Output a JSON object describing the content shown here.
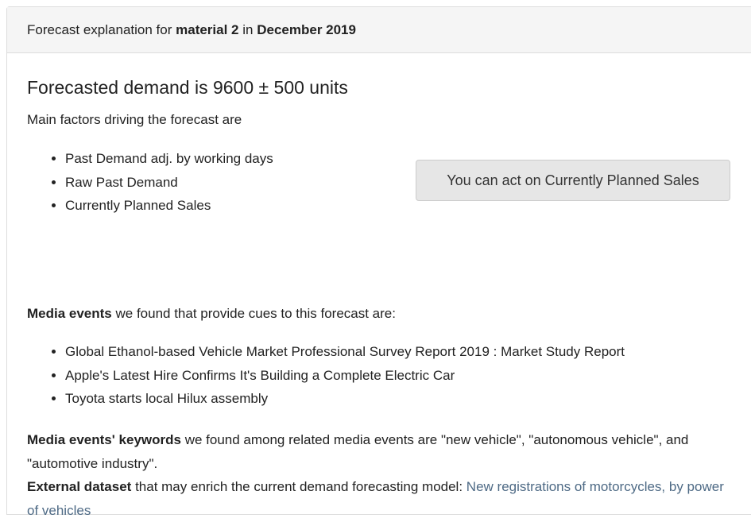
{
  "header": {
    "prefix": "Forecast explanation for",
    "material": "material 2",
    "connector": "in",
    "period": "December 2019"
  },
  "forecast": {
    "headline": "Forecasted demand is 9600 ± 500 units",
    "factors_intro": "Main factors driving the forecast are",
    "factors": [
      "Past Demand adj. by working days",
      "Raw Past Demand",
      "Currently Planned Sales"
    ],
    "action_button_label": "You can act on Currently Planned Sales"
  },
  "media": {
    "intro_bold": "Media events",
    "intro_rest": " we found that provide cues to this forecast are:",
    "events": [
      "Global Ethanol-based Vehicle Market Professional Survey Report 2019 : Market Study Report",
      "Apple's Latest Hire Confirms It's Building a Complete Electric Car",
      "Toyota starts local Hilux assembly"
    ]
  },
  "keywords": {
    "label_bold": "Media events' keywords",
    "text": " we found among related media events are \"new vehicle\", \"autonomous vehicle\", and \"automotive industry\"."
  },
  "dataset": {
    "label_bold": "External dataset",
    "text": " that may enrich the current demand forecasting model: ",
    "link_text": "New registrations of motorcycles, by power of vehicles",
    "link_color": "#4e6a85"
  }
}
